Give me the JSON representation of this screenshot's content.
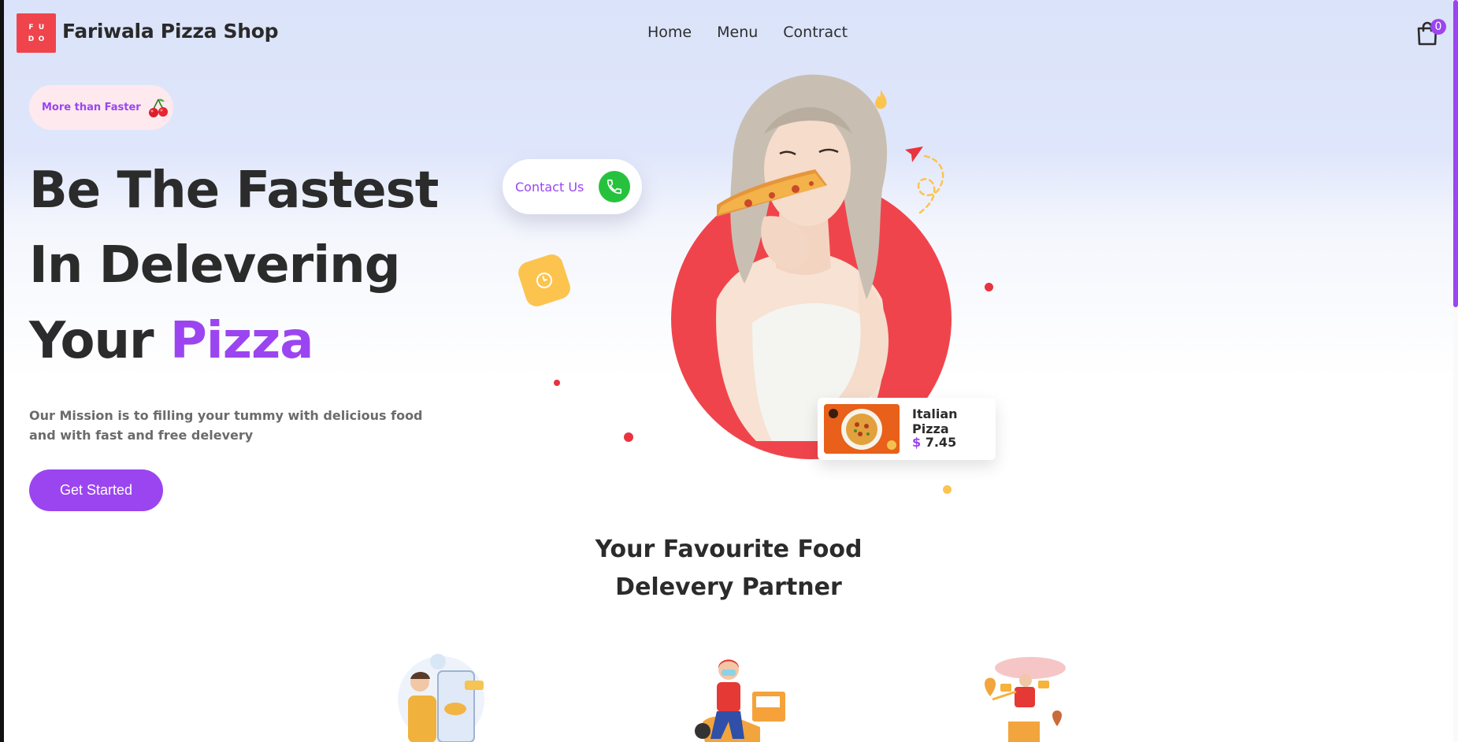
{
  "header": {
    "logo_letters": [
      "F",
      "U",
      "D",
      "O"
    ],
    "brand": "Fariwala Pizza Shop",
    "nav": [
      "Home",
      "Menu",
      "Contract"
    ],
    "cart_count": "0"
  },
  "hero": {
    "tagline": "More than Faster",
    "headline_line1": "Be The Fastest",
    "headline_line2": "In Delevering",
    "headline_line3_prefix": "Your ",
    "headline_line3_accent": "Pizza",
    "mission": "Our Mission is to filling your tummy with delicious food and with fast and free delevery",
    "cta": "Get Started",
    "contact_label": "Contact Us"
  },
  "product_card": {
    "name": "Italian Pizza",
    "currency": "$",
    "price": "7.45"
  },
  "section": {
    "title_line1": "Your Favourite Food",
    "title_line2": "Delevery Partner"
  },
  "colors": {
    "accent": "#9b45f0",
    "brand_red": "#f0444c",
    "phone_green": "#27c23d",
    "yellow": "#fcc44e",
    "hero_bg": "#dbe3fa"
  },
  "icons": [
    "cherry-icon",
    "phone-icon",
    "clock-icon",
    "shopping-bag-icon"
  ]
}
